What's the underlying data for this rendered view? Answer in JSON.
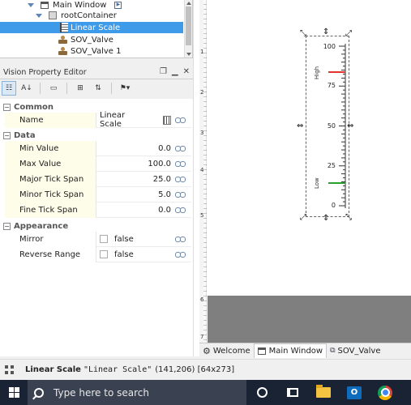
{
  "tree": {
    "items": [
      {
        "label": "Main Window"
      },
      {
        "label": "rootContainer"
      },
      {
        "label": "Linear Scale"
      },
      {
        "label": "SOV_Valve"
      },
      {
        "label": "SOV_Valve 1"
      }
    ]
  },
  "property_editor": {
    "title": "Vision Property Editor",
    "categories": [
      {
        "label": "Common"
      },
      {
        "label": "Data"
      },
      {
        "label": "Appearance"
      }
    ],
    "props": [
      {
        "name": "Name",
        "value": "Linear Scale"
      },
      {
        "name": "Min Value",
        "value": "0.0"
      },
      {
        "name": "Max Value",
        "value": "100.0"
      },
      {
        "name": "Major Tick Span",
        "value": "25.0"
      },
      {
        "name": "Minor Tick Span",
        "value": "5.0"
      },
      {
        "name": "Fine Tick Span",
        "value": "0.0"
      },
      {
        "name": "Mirror",
        "value": "false"
      },
      {
        "name": "Reverse Range",
        "value": "false"
      }
    ]
  },
  "canvas": {
    "ruler_numbers": [
      "1",
      "2",
      "3",
      "4",
      "5",
      "6",
      "7"
    ],
    "scale_labels": [
      "100",
      "75",
      "50",
      "25",
      "0"
    ],
    "range_labels": [
      "High",
      "Low"
    ],
    "colors": {
      "high": "#e0342c",
      "low": "#2ca02c",
      "gray_area": "#7f7f7f"
    }
  },
  "tabs": [
    {
      "label": "Welcome",
      "icon": "gear-icon"
    },
    {
      "label": "Main Window",
      "icon": "window-icon"
    },
    {
      "label": "SOV_Valve",
      "icon": "component-icon"
    }
  ],
  "status": {
    "name": "Linear Scale",
    "detail": "\"Linear Scale\"",
    "coords": "(141,206) [64x273]"
  },
  "taskbar": {
    "search_placeholder": "Type here to search"
  }
}
